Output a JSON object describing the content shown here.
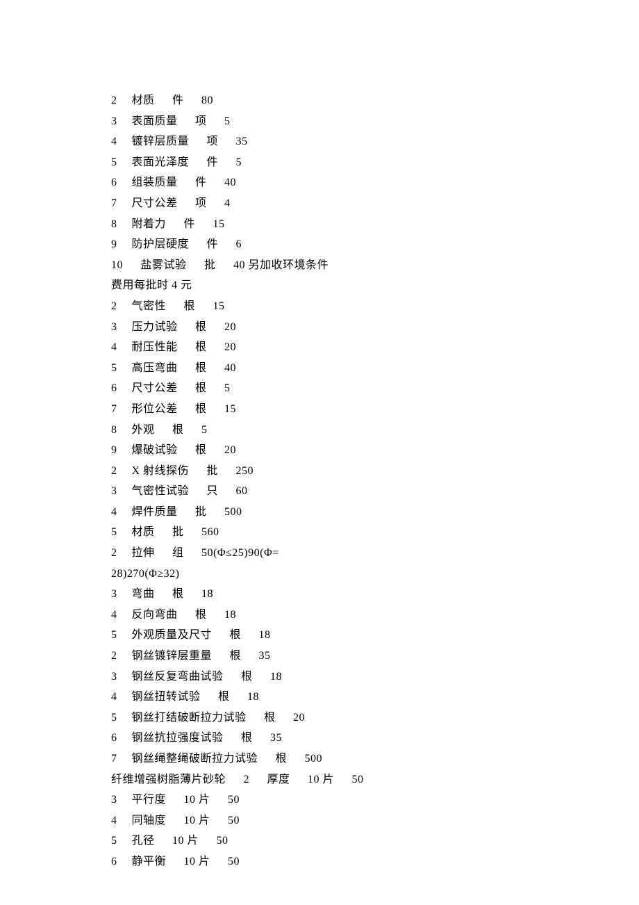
{
  "lines": [
    "2　 材质　  件　  80",
    "3　 表面质量　  项　  5",
    "4　 镀锌层质量　  项　  35",
    "5　 表面光泽度　  件　  5",
    "6　 组装质量　  件　  40",
    "7　 尺寸公差　  项　  4",
    "8　 附着力　  件　  15",
    "9　 防护层硬度　  件　  6",
    "10　  盐雾试验　  批　  40 另加收环境条件",
    "费用每批时 4 元",
    "2　 气密性　  根　  15",
    "3　 压力试验　  根　  20",
    "4　 耐压性能　  根　  20",
    "5　 高压弯曲　  根　  40",
    "6　 尺寸公差　  根　  5",
    "7　 形位公差　  根　  15",
    "8　 外观　  根　  5",
    "9　 爆破试验　  根　  20",
    "2　 X 射线探伤　  批　  250",
    "3　 气密性试验　  只　  60",
    "4　 焊件质量　  批　  500",
    "5　 材质　  批　  560",
    "2　 拉伸　  组　  50(Φ≤25)90(Φ=",
    "28)270(Φ≥32)",
    "3　 弯曲　  根　  18",
    "4　 反向弯曲　  根　  18",
    "5　 外观质量及尺寸　  根　  18",
    "2　 钢丝镀锌层重量　  根　  35",
    "3　 钢丝反复弯曲试验　  根　  18",
    "4　 钢丝扭转试验　  根　  18",
    "5　 钢丝打结破断拉力试验　  根　  20",
    "6　 钢丝抗拉强度试验　  根　  35",
    "7　 钢丝绳整绳破断拉力试验　  根　  500",
    "纤维增强树脂薄片砂轮　  2　  厚度　  10 片　  50",
    "3　 平行度　  10 片　  50",
    "4　 同轴度　  10 片　  50",
    "5　 孔径　  10 片　  50",
    "6　 静平衡　  10 片　  50"
  ]
}
